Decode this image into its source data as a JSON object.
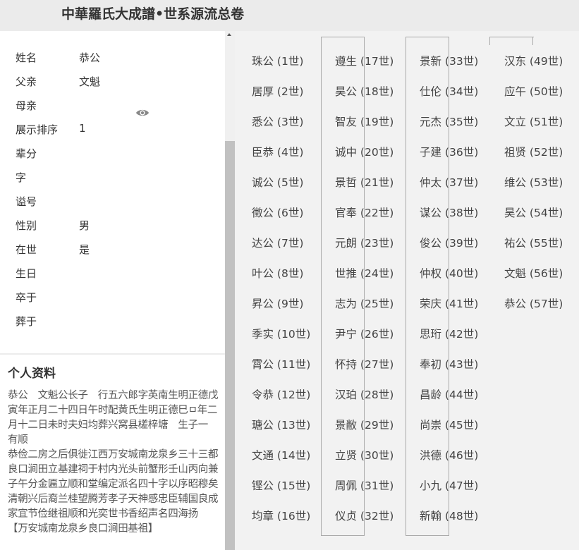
{
  "header": {
    "title": "中華羅氏大成譜•世系源流总卷"
  },
  "person": {
    "fields": [
      {
        "label": "姓名",
        "value": "恭公"
      },
      {
        "label": "父亲",
        "value": "文魁"
      },
      {
        "label": "母亲",
        "value": ""
      },
      {
        "label": "展示排序",
        "value": "1"
      },
      {
        "label": "辈分",
        "value": ""
      },
      {
        "label": "字",
        "value": ""
      },
      {
        "label": "谥号",
        "value": ""
      },
      {
        "label": "性别",
        "value": "男"
      },
      {
        "label": "在世",
        "value": "是"
      },
      {
        "label": "生日",
        "value": ""
      },
      {
        "label": "卒于",
        "value": ""
      },
      {
        "label": "葬于",
        "value": ""
      }
    ]
  },
  "profile": {
    "title": "个人资料",
    "text": "恭公　文魁公长子　行五六郎字英南生明正德戊寅年正月二十四日午时配黄氏生明正德巳ㅁ年二月十二日未时夫妇均葬兴窝县槎梓塘　生子一　有顺\n恭俭二房之后俱徙江西万安城南龙泉乡三十三都良口涧田立基建祠于村内光头前蟹形壬山丙向兼子午分金匾立顺和堂编定派名四十字以序昭穆矣清朝兴后裔兰桂望腾芳孝子天神感忠臣辅国良成家宜节俭继祖顺和光奕世书香绍声名四海扬　【万安城南龙泉乡良口涧田基祖】"
  },
  "generations": [
    {
      "name": "珠公",
      "gen": "(1世)"
    },
    {
      "name": "居厚",
      "gen": "(2世)"
    },
    {
      "name": "悉公",
      "gen": "(3世)"
    },
    {
      "name": "臣恭",
      "gen": "(4世)"
    },
    {
      "name": "诚公",
      "gen": "(5世)"
    },
    {
      "name": "徵公",
      "gen": "(6世)"
    },
    {
      "name": "达公",
      "gen": "(7世)"
    },
    {
      "name": "叶公",
      "gen": "(8世)"
    },
    {
      "name": "昇公",
      "gen": "(9世)"
    },
    {
      "name": "季实",
      "gen": "(10世)"
    },
    {
      "name": "霄公",
      "gen": "(11世)"
    },
    {
      "name": "令恭",
      "gen": "(12世)"
    },
    {
      "name": "瑭公",
      "gen": "(13世)"
    },
    {
      "name": "文通",
      "gen": "(14世)"
    },
    {
      "name": "铿公",
      "gen": "(15世)"
    },
    {
      "name": "均章",
      "gen": "(16世)"
    },
    {
      "name": "遵生",
      "gen": "(17世)"
    },
    {
      "name": "昊公",
      "gen": "(18世)"
    },
    {
      "name": "智友",
      "gen": "(19世)"
    },
    {
      "name": "诚中",
      "gen": "(20世)"
    },
    {
      "name": "景哲",
      "gen": "(21世)"
    },
    {
      "name": "官奉",
      "gen": "(22世)"
    },
    {
      "name": "元朗",
      "gen": "(23世)"
    },
    {
      "name": "世推",
      "gen": "(24世)"
    },
    {
      "name": "志为",
      "gen": "(25世)"
    },
    {
      "name": "尹宁",
      "gen": "(26世)"
    },
    {
      "name": "怀持",
      "gen": "(27世)"
    },
    {
      "name": "汉珀",
      "gen": "(28世)"
    },
    {
      "name": "景敝",
      "gen": "(29世)"
    },
    {
      "name": "立贤",
      "gen": "(30世)"
    },
    {
      "name": "周佩",
      "gen": "(31世)"
    },
    {
      "name": "仪贞",
      "gen": "(32世)"
    },
    {
      "name": "景新",
      "gen": "(33世)"
    },
    {
      "name": "仕伦",
      "gen": "(34世)"
    },
    {
      "name": "元杰",
      "gen": "(35世)"
    },
    {
      "name": "子建",
      "gen": "(36世)"
    },
    {
      "name": "仲太",
      "gen": "(37世)"
    },
    {
      "name": "谋公",
      "gen": "(38世)"
    },
    {
      "name": "俊公",
      "gen": "(39世)"
    },
    {
      "name": "仲权",
      "gen": "(40世)"
    },
    {
      "name": "荣庆",
      "gen": "(41世)"
    },
    {
      "name": "思珩",
      "gen": "(42世)"
    },
    {
      "name": "奉初",
      "gen": "(43世)"
    },
    {
      "name": "昌龄",
      "gen": "(44世)"
    },
    {
      "name": "尚崇",
      "gen": "(45世)"
    },
    {
      "name": "洪德",
      "gen": "(46世)"
    },
    {
      "name": "小九",
      "gen": "(47世)"
    },
    {
      "name": "新翰",
      "gen": "(48世)"
    },
    {
      "name": "汉东",
      "gen": "(49世)"
    },
    {
      "name": "应午",
      "gen": "(50世)"
    },
    {
      "name": "文立",
      "gen": "(51世)"
    },
    {
      "name": "祖贤",
      "gen": "(52世)"
    },
    {
      "name": "维公",
      "gen": "(53世)"
    },
    {
      "name": "昊公",
      "gen": "(54世)"
    },
    {
      "name": "祐公",
      "gen": "(55世)"
    },
    {
      "name": "文魁",
      "gen": "(56世)"
    },
    {
      "name": "恭公",
      "gen": "(57世)"
    }
  ]
}
